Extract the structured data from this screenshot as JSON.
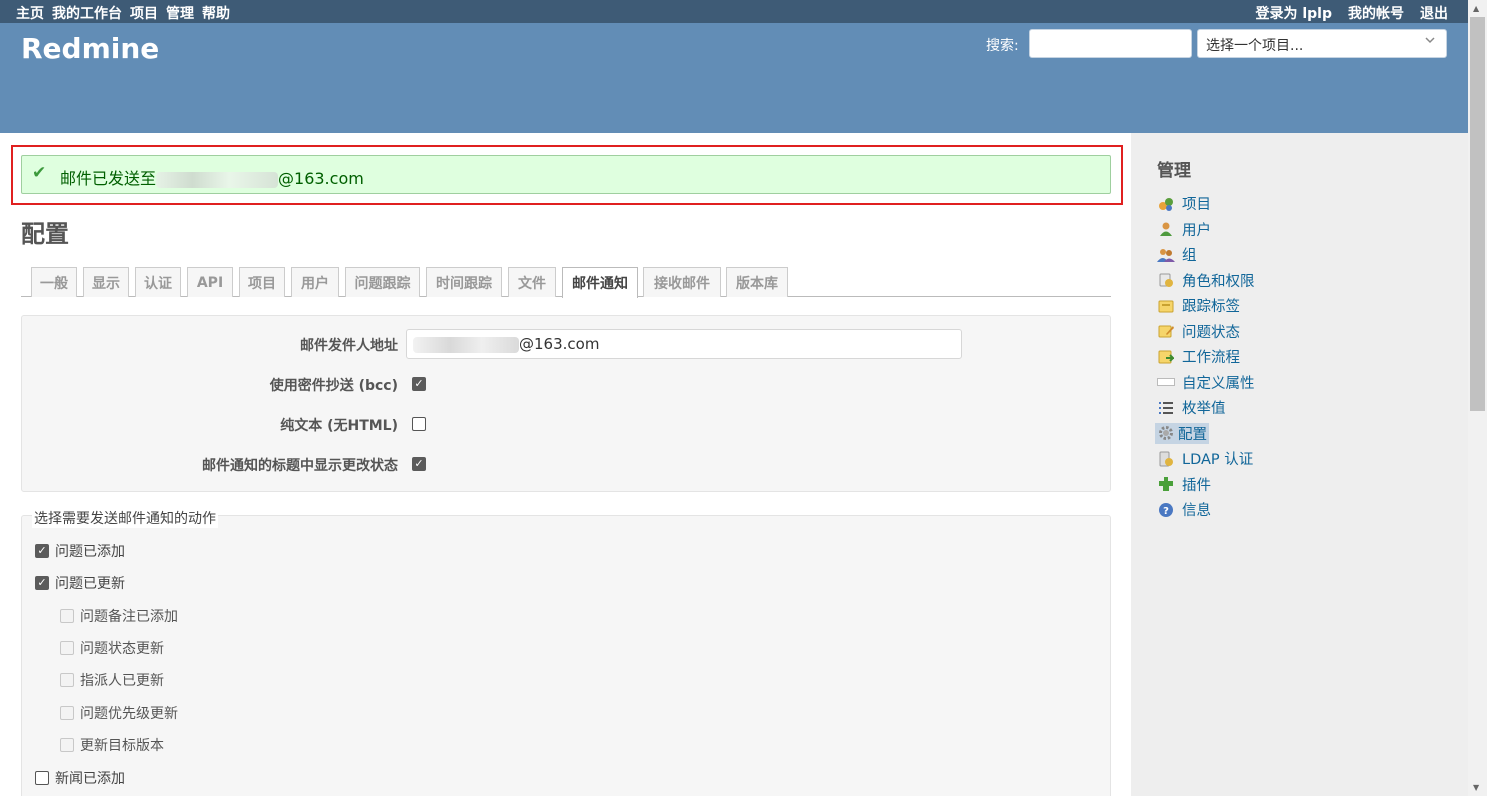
{
  "top_menu": {
    "items": [
      "主页",
      "我的工作台",
      "项目",
      "管理",
      "帮助"
    ],
    "logged_as_label": "登录为",
    "user": "lplp",
    "my_account": "我的帐号",
    "logout": "退出"
  },
  "header": {
    "title": "Redmine",
    "search_label": "搜索:",
    "project_select": "选择一个项目..."
  },
  "flash": {
    "message_prefix": "邮件已发送至",
    "message_suffix": "@163.com"
  },
  "page_title": "配置",
  "tabs": [
    "一般",
    "显示",
    "认证",
    "API",
    "项目",
    "用户",
    "问题跟踪",
    "时间跟踪",
    "文件",
    "邮件通知",
    "接收邮件",
    "版本库"
  ],
  "selected_tab": "邮件通知",
  "settings": {
    "from_label": "邮件发件人地址",
    "from_value_suffix": "@163.com",
    "bcc_label": "使用密件抄送 (bcc)",
    "bcc_checked": true,
    "plain_text_label": "纯文本 (无HTML)",
    "plain_text_checked": false,
    "status_in_subject_label": "邮件通知的标题中显示更改状态",
    "status_in_subject_checked": true
  },
  "notifications": {
    "legend": "选择需要发送邮件通知的动作",
    "items": [
      {
        "label": "问题已添加",
        "checked": true,
        "indent": false,
        "disabled": false
      },
      {
        "label": "问题已更新",
        "checked": true,
        "indent": false,
        "disabled": false
      },
      {
        "label": "问题备注已添加",
        "checked": false,
        "indent": true,
        "disabled": true
      },
      {
        "label": "问题状态更新",
        "checked": false,
        "indent": true,
        "disabled": true
      },
      {
        "label": "指派人已更新",
        "checked": false,
        "indent": true,
        "disabled": true
      },
      {
        "label": "问题优先级更新",
        "checked": false,
        "indent": true,
        "disabled": true
      },
      {
        "label": "更新目标版本",
        "checked": false,
        "indent": true,
        "disabled": true
      },
      {
        "label": "新闻已添加",
        "checked": false,
        "indent": false,
        "disabled": false
      }
    ]
  },
  "sidebar": {
    "title": "管理",
    "items": [
      {
        "label": "项目",
        "icon": "projects-icon"
      },
      {
        "label": "用户",
        "icon": "user-icon"
      },
      {
        "label": "组",
        "icon": "group-icon"
      },
      {
        "label": "角色和权限",
        "icon": "roles-icon"
      },
      {
        "label": "跟踪标签",
        "icon": "tracker-icon"
      },
      {
        "label": "问题状态",
        "icon": "issue-status-icon"
      },
      {
        "label": "工作流程",
        "icon": "workflow-icon"
      },
      {
        "label": "自定义属性",
        "icon": "custom-field-icon"
      },
      {
        "label": "枚举值",
        "icon": "list-icon"
      },
      {
        "label": "配置",
        "icon": "gear-icon"
      },
      {
        "label": "LDAP 认证",
        "icon": "server-auth-icon"
      },
      {
        "label": "插件",
        "icon": "plugin-icon"
      },
      {
        "label": "信息",
        "icon": "help-icon"
      }
    ],
    "selected": "配置"
  },
  "colors": {
    "top_menu_bg": "#3e5b76",
    "header_bg": "#628db6",
    "flash_bg": "#dfffdf",
    "link": "#116699",
    "flash_outline": "#e02020"
  }
}
